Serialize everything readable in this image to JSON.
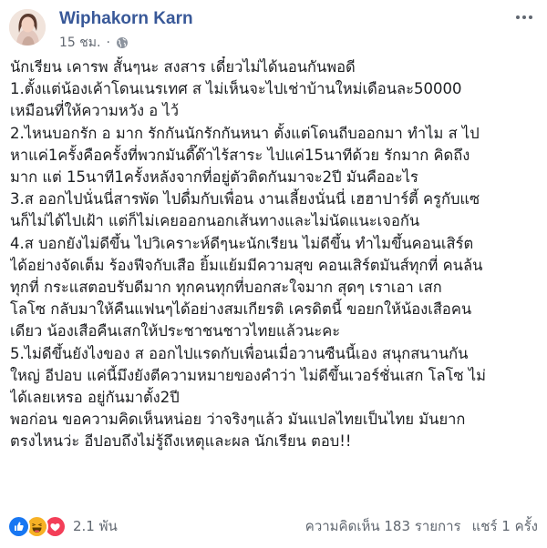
{
  "author": {
    "name": "Wiphakorn Karn"
  },
  "meta": {
    "time": "15 ชม.",
    "separator": "·",
    "privacy_icon": "globe-icon"
  },
  "options_icon": "more-options-icon",
  "post": {
    "lines": [
      "นักเรียน เคารพ สั้นๆนะ สงสาร เดี๋ยวไม่ได้นอนกันพอดี",
      "1.ตั้งแต่น้องเค้าโดนเนรเทศ ส ไม่เห็นจะไปเช่าบ้านใหม่เดือนละ50000",
      "เหมือนที่ให้ความหวัง อ ไว้",
      "2.ไหนบอกรัก อ มาก รักกันนักรักกันหนา ตั้งแต่โดนถีบออกมา ทำไม ส ไป",
      "หาแค่1ครั้งคือครั้งที่พวกมันดี๊ด๊าไร้สาระ ไปแค่15นาทีด้วย รักมาก คิดถึง",
      "มาก แต่ 15นาที1ครั้งหลังจากที่อยู่ตัวติดกันมาจะ2ปี มันคืออะไร",
      "3.ส ออกไปนั่นนี่สารพัด ไปดื่มกับเพื่อน งานเลี้ยงนั่นนี่ เฮฮาปาร์ตี้ ครูกับแซ",
      "นก็ไม่ได้ไปเฝ้า แต่ก็ไม่เคยออกนอกเส้นทางและไม่นัดแนะเจอกัน",
      "4.ส บอกยังไม่ดีขึ้น ไปวิเคราะห์ดีๆนะนักเรียน ไม่ดีขึ้น ทำไมขึ้นคอนเสิร์ต",
      "ได้อย่างจัดเต็ม ร้องฟีจกับเสือ ยิ้มแย้มมีความสุข คอนเสิร์ตมันส์ทุกที่ คนล้น",
      "ทุกที่ กระแสตอบรับดีมาก ทุกคนทุกที่บอกสะใจมาก สุดๆ เราเอา เสก",
      "โลโซ กลับมาให้คืนแฟนๆได้อย่างสมเกียรติ เครดิตนี้ ขอยกให้น้องเสือคน",
      "เดียว น้องเสือคืนเสกให้ประชาชนชาวไทยแล้วนะคะ",
      "5.ไม่ดีขึ้นยังไงของ ส ออกไปแรดกับเพื่อนเมื่อวานซืนนี้เอง สนุกสนานกัน",
      "ใหญ่ อีปอบ แค่นี้มึงยังตีความหมายของคำว่า ไม่ดีขึ้นเวอร์ชั่นเสก โลโซ ไม่",
      "ได้เลยเหรอ อยู่กันมาตั้ง2ปี",
      "พอก่อน ขอความคิดเห็นหน่อย ว่าจริงๆแล้ว มันแปลไทยเป็นไทย มันยาก",
      "ตรงไหนว่ะ อีปอบถึงไม่รู้ถึงเหตุและผล นักเรียน ตอบ!!"
    ]
  },
  "reactions": {
    "icons": [
      "like-icon",
      "haha-icon",
      "love-icon"
    ],
    "colors": {
      "like": "#1877f2",
      "haha": "#f7b125",
      "love": "#f33e58"
    },
    "count": "2.1 พัน"
  },
  "stats": {
    "comments": "ความคิดเห็น 183 รายการ",
    "shares": "แชร์ 1 ครั้ง"
  }
}
